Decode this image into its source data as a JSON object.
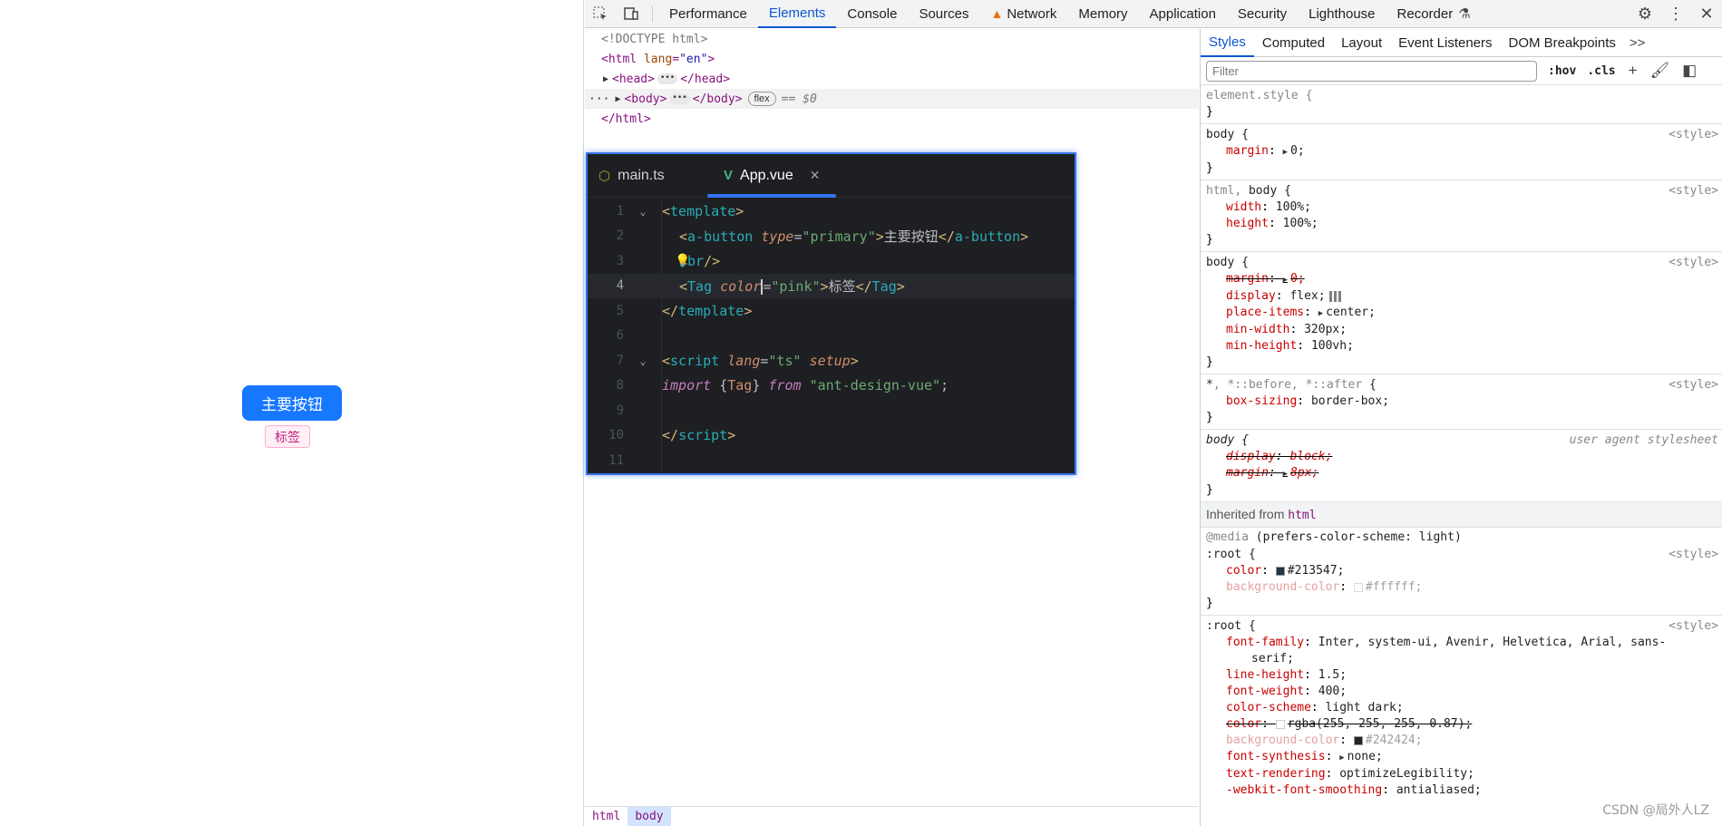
{
  "app_preview": {
    "primary_button_label": "主要按钮",
    "tag_label": "标签"
  },
  "devtools": {
    "tabs": [
      "Performance",
      "Elements",
      "Console",
      "Sources",
      "Network",
      "Memory",
      "Application",
      "Security",
      "Lighthouse",
      "Recorder"
    ],
    "active_tab": "Elements",
    "dom_tree": {
      "doctype": "<!DOCTYPE html>",
      "html_open_tag": "<html",
      "html_lang_attr": "lang",
      "html_lang_value": "\"en\"",
      "head": "<head>",
      "head_close": "</head>",
      "body": "<body>",
      "body_close": "</body>",
      "flex_badge": "flex",
      "dollar_ref": "== $0",
      "html_close": "</html>"
    },
    "breadcrumb": [
      "html",
      "body"
    ],
    "styles_tabs": [
      "Styles",
      "Computed",
      "Layout",
      "Event Listeners",
      "DOM Breakpoints"
    ],
    "styles_more": ">>",
    "filter_placeholder": "Filter",
    "hov_label": ":hov",
    "cls_label": ".cls",
    "rules": {
      "element_style": "element.style {",
      "r1_selector": "body {",
      "r1_origin": "<style>",
      "r1_margin_name": "margin",
      "r1_margin_value": "0;",
      "r2_selector_dim": "html,",
      "r2_selector": " body {",
      "r2_origin": "<style>",
      "r2_width_name": "width",
      "r2_width_value": "100%;",
      "r2_height_name": "height",
      "r2_height_value": "100%;",
      "r3_selector": "body {",
      "r3_origin": "<style>",
      "r3_margin_name": "margin",
      "r3_margin_value": "0;",
      "r3_display_name": "display",
      "r3_display_value": "flex;",
      "r3_place_name": "place-items",
      "r3_place_value": "center;",
      "r3_minw_name": "min-width",
      "r3_minw_value": "320px;",
      "r3_minh_name": "min-height",
      "r3_minh_value": "100vh;",
      "r4_selector_a": "*",
      "r4_selector_dim": ", *::before, *::after",
      "r4_selector_b": " {",
      "r4_origin": "<style>",
      "r4_bs_name": "box-sizing",
      "r4_bs_value": "border-box;",
      "r5_selector": "body {",
      "r5_origin": "user agent stylesheet",
      "r5_display_name": "display",
      "r5_display_value": "block;",
      "r5_margin_name": "margin",
      "r5_margin_value": "8px;",
      "inherited_label": "Inherited from",
      "inherited_tag": "html",
      "media_at": "@media",
      "media_query": " (prefers-color-scheme: light)",
      "r6_selector": ":root {",
      "r6_origin": "<style>",
      "r6_color_name": "color",
      "r6_color_value": "#213547;",
      "r6_bg_name": "background-color",
      "r6_bg_value": "#ffffff;",
      "r7_selector": ":root {",
      "r7_origin": "<style>",
      "r7_ff_name": "font-family",
      "r7_ff_value": "Inter, system-ui, Avenir, Helvetica, Arial, sans-",
      "r7_ff_value2": "serif;",
      "r7_lh_name": "line-height",
      "r7_lh_value": "1.5;",
      "r7_fw_name": "font-weight",
      "r7_fw_value": "400;",
      "r7_cs_name": "color-scheme",
      "r7_cs_value": "light dark;",
      "r7_color_name": "color",
      "r7_color_value": "rgba(255, 255, 255, 0.87);",
      "r7_bg_name": "background-color",
      "r7_bg_value": "#242424;",
      "r7_fs_name": "font-synthesis",
      "r7_fs_value": "none;",
      "r7_tr_name": "text-rendering",
      "r7_tr_value": "optimizeLegibility;",
      "r7_wf_name": "-webkit-font-smoothing",
      "r7_wf_value": "antialiased;",
      "close_brace": "}"
    },
    "colors": {
      "swatch_213547": "#213547",
      "swatch_ffffff": "#ffffff",
      "swatch_rgba": "rgba(255,255,255,0.87)",
      "swatch_242424": "#242424"
    }
  },
  "ide": {
    "tabs": [
      {
        "label": "main.ts",
        "icon": "js-icon"
      },
      {
        "label": "App.vue",
        "icon": "vue-icon"
      }
    ],
    "line_numbers": [
      "1",
      "2",
      "3",
      "4",
      "5",
      "6",
      "7",
      "8",
      "9",
      "10",
      "11"
    ],
    "code": {
      "l1_open": "<",
      "l1_tag": "template",
      "l1_close": ">",
      "l2_open": "<",
      "l2_tag": "a-button",
      "l2_attr": "type",
      "l2_eq": "=",
      "l2_val": "\"primary\"",
      "l2_gt": ">",
      "l2_text": "主要按钮",
      "l2_close_open": "</",
      "l2_close_tag": "a-button",
      "l2_close_gt": ">",
      "l3_open": "<",
      "l3_tag": "br",
      "l3_close": "/>",
      "l4_open": "<",
      "l4_tag": "Tag",
      "l4_attr": "color",
      "l4_eq": "=",
      "l4_val": "\"pink\"",
      "l4_gt": ">",
      "l4_text": "标签",
      "l4_close_open": "</",
      "l4_close_tag": "Tag",
      "l4_close_gt": ">",
      "l5_open": "</",
      "l5_tag": "template",
      "l5_close": ">",
      "l7_open": "<",
      "l7_tag": "script",
      "l7_attr1": "lang",
      "l7_eq": "=",
      "l7_val": "\"ts\"",
      "l7_attr2": "setup",
      "l7_close": ">",
      "l8_kw": "import",
      "l8_brace_open": "{",
      "l8_name": "Tag",
      "l8_brace_close": "}",
      "l8_from": "from",
      "l8_str": "\"ant-design-vue\"",
      "l8_semi": ";",
      "l10_open": "</",
      "l10_tag": "script",
      "l10_close": ">"
    }
  },
  "watermark": "CSDN @局外人LZ"
}
